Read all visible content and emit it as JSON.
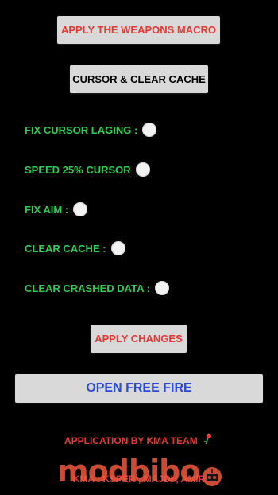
{
  "colors": {
    "background": "#000000",
    "button_bg": "#d9d9d9",
    "red_text": "#e53935",
    "black_text": "#000000",
    "blue_text": "#2a4bd7",
    "green_text": "#2ecc52",
    "radio_fill": "#f2f2f2",
    "watermark": "#f05a3c"
  },
  "buttons": {
    "weapons_macro": "APPLY THE WEAPONS MACRO",
    "cursor_clear_cache": "CURSOR & CLEAR CACHE",
    "apply_changes": "APPLY CHANGES",
    "open_free_fire": "OPEN FREE FIRE"
  },
  "options": [
    {
      "label": "FIX CURSOR LAGING :",
      "checked": false
    },
    {
      "label": "SPEED 25% CURSOR",
      "checked": false
    },
    {
      "label": "FIX AIM :",
      "checked": false
    },
    {
      "label": "CLEAR CACHE :",
      "checked": false
    },
    {
      "label": "CLEAR CRASHED DATA :",
      "checked": false
    }
  ],
  "footer": {
    "application_credit": "APPLICATION BY KMA TEAM",
    "team_members": "KMA : KSPER , MAJDI , AMIR",
    "watermark": "modbibo"
  },
  "icons": {
    "credit_icon": "rose-icon",
    "watermark_icon": "robot-icon"
  }
}
